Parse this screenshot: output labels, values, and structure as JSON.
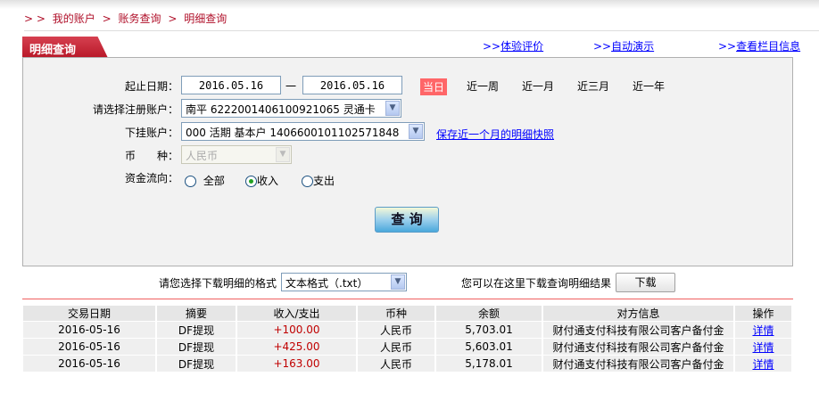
{
  "breadcrumb": {
    "prefix": "> >",
    "items": [
      "我的账户",
      "账务查询",
      "明细查询"
    ],
    "sep": ">"
  },
  "tab": {
    "title": "明细查询"
  },
  "top_links": [
    {
      "prefix": ">>",
      "label": "体验评价"
    },
    {
      "prefix": ">>",
      "label": "自动演示"
    },
    {
      "prefix": ">>",
      "label": "查看栏目信息"
    }
  ],
  "form": {
    "date_label": "起止日期：",
    "start_date": "2016.05.16",
    "dash": "一",
    "end_date": "2016.05.16",
    "quick_ranges": [
      "当日",
      "近一周",
      "近一月",
      "近三月",
      "近一年"
    ],
    "quick_selected": "当日",
    "account_label": "请选择注册账户：",
    "account_value": "南平 6222001406100921065 灵通卡",
    "sub_account_label": "下挂账户：",
    "sub_account_value": "000 活期 基本户 1406600101102571848",
    "snapshot_link": "保存近一个月的明细快照",
    "currency_label": "币　　种：",
    "currency_value": "人民币",
    "flow_label": "资金流向：",
    "flow_options": [
      "全部",
      "收入",
      "支出"
    ],
    "flow_selected": "收入",
    "query_button": "查 询"
  },
  "download": {
    "format_label": "请您选择下载明细的格式",
    "format_value": "文本格式（.txt）",
    "hint": "您可以在这里下载查询明细结果",
    "button": "下载"
  },
  "table": {
    "headers": [
      "交易日期",
      "摘要",
      "收入/支出",
      "币种",
      "余额",
      "对方信息",
      "操作"
    ],
    "rows": [
      [
        "2016-05-16",
        "DF提现",
        "+100.00",
        "人民币",
        "5,703.01",
        "财付通支付科技有限公司客户备付金",
        "详情"
      ],
      [
        "2016-05-16",
        "DF提现",
        "+425.00",
        "人民币",
        "5,603.01",
        "财付通支付科技有限公司客户备付金",
        "详情"
      ],
      [
        "2016-05-16",
        "DF提现",
        "+163.00",
        "人民币",
        "5,178.01",
        "财付通支付科技有限公司客户备付金",
        "详情"
      ]
    ]
  },
  "colors": {
    "brand_red": "#b81828",
    "today_bg": "#ff6668",
    "amount": "#c00000",
    "link": "#0000ff"
  }
}
